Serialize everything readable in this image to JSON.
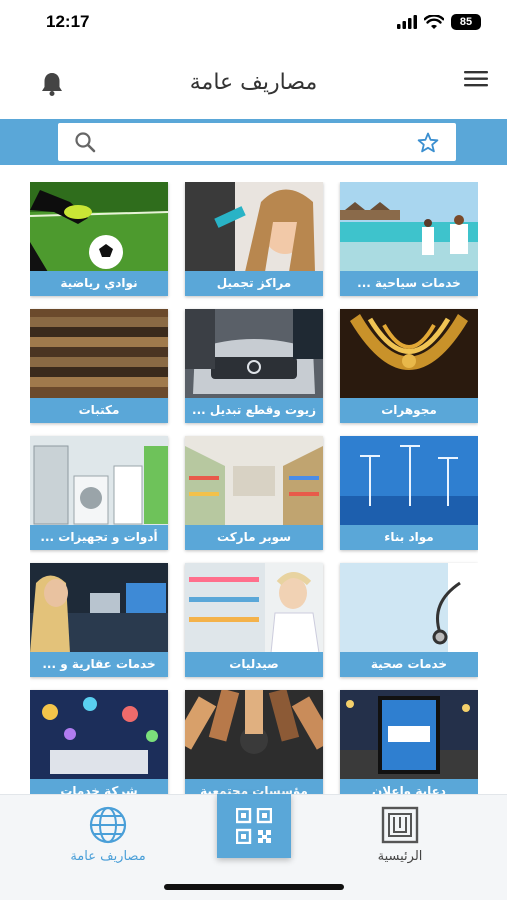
{
  "status_bar": {
    "time": "12:17",
    "battery": "85"
  },
  "header": {
    "title": "مصاريف عامة"
  },
  "search": {
    "placeholder": "",
    "value": ""
  },
  "tiles": [
    {
      "label": "خدمات سياحية ..."
    },
    {
      "label": "مراكز تجميل"
    },
    {
      "label": "نوادي رياضية"
    },
    {
      "label": "مجوهرات"
    },
    {
      "label": "زيوت وقطع تبديل ..."
    },
    {
      "label": "مكتبات"
    },
    {
      "label": "مواد بناء"
    },
    {
      "label": "سوبر ماركت"
    },
    {
      "label": "أدوات و تجهيزات ..."
    },
    {
      "label": "خدمات صحية"
    },
    {
      "label": "صيدليات"
    },
    {
      "label": "خدمات عقارية و ..."
    },
    {
      "label": "دعاية وإعلان"
    },
    {
      "label": "مؤسسات مجتمعية"
    },
    {
      "label": "شركة خدمات"
    }
  ],
  "bottom_nav": {
    "general_expenses": "مصاريف عامة",
    "home": "الرئيسية"
  },
  "colors": {
    "accent": "#5aa7d8"
  }
}
